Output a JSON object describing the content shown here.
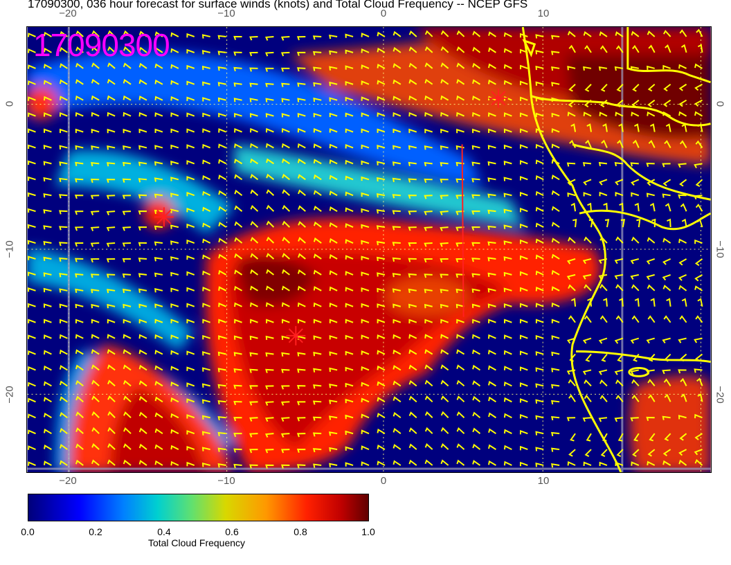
{
  "title": "17090300, 036 hour forecast for surface winds (knots) and Total Cloud Frequency -- NCEP GFS",
  "stamp": "17090300",
  "axes": {
    "x_ticks": [
      "−20",
      "−10",
      "0",
      "10"
    ],
    "y_ticks": [
      "0",
      "−10",
      "−20"
    ]
  },
  "colorbar": {
    "title": "Total Cloud Frequency",
    "ticks": [
      "0.0",
      "0.2",
      "0.4",
      "0.6",
      "0.8",
      "1.0"
    ],
    "range": [
      0.0,
      1.0
    ]
  },
  "map": {
    "lon_range": [
      -22.5,
      20
    ],
    "lat_range": [
      -25,
      5
    ],
    "coastline_color": "#ffff00",
    "wind_barb_color": "#ffff00",
    "marker_color": "#ff2020",
    "markers": [
      {
        "lon": -14,
        "lat": -7.8
      },
      {
        "lon": -5.8,
        "lat": -15.8
      },
      {
        "lon": 6.8,
        "lat": 0.2
      }
    ]
  }
}
